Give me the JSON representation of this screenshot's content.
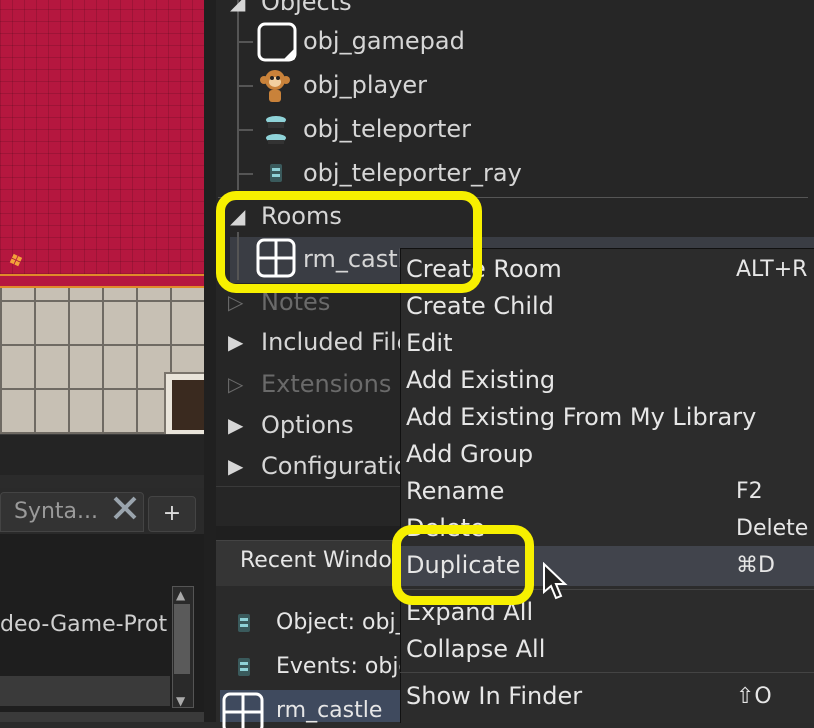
{
  "tree": {
    "objects_label": "Objects",
    "items": [
      {
        "label": "obj_gamepad",
        "icon": "gamepad-object-icon"
      },
      {
        "label": "obj_player",
        "icon": "monkey-sprite-icon"
      },
      {
        "label": "obj_teleporter",
        "icon": "teleporter-sprite-icon"
      },
      {
        "label": "obj_teleporter_ray",
        "icon": "teleporter-ray-sprite-icon"
      }
    ],
    "rooms_label": "Rooms",
    "room_item": "rm_castle",
    "notes_label": "Notes",
    "included_files_label": "Included File",
    "extensions_label": "Extensions",
    "options_label": "Options",
    "configurations_label": "Configuratio"
  },
  "bottom_left": {
    "syntax_tab": "Synta...",
    "close_icon": "x-icon",
    "plus": "+",
    "code_text": "deo-Game-Prot"
  },
  "recent": {
    "header": "Recent Window",
    "items": [
      "Object: obj_",
      "Events: obje",
      "rm_castle"
    ]
  },
  "menu": {
    "items": [
      {
        "label": "Create Room",
        "shortcut": "ALT+R"
      },
      {
        "label": "Create Child",
        "shortcut": ""
      },
      {
        "label": "Edit",
        "shortcut": ""
      },
      {
        "label": "Add Existing",
        "shortcut": ""
      },
      {
        "label": "Add Existing From My Library",
        "shortcut": ""
      },
      {
        "label": "Add Group",
        "shortcut": ""
      },
      {
        "label": "Rename",
        "shortcut": "F2"
      },
      {
        "label": "Delete",
        "shortcut": "Delete"
      },
      {
        "label": "Duplicate",
        "shortcut": "⌘D"
      },
      {
        "label": "Expand All",
        "shortcut": ""
      },
      {
        "label": "Collapse All",
        "shortcut": ""
      },
      {
        "label": "Show In Finder",
        "shortcut": "⇧O"
      }
    ]
  },
  "colors": {
    "highlight": "#f7f000",
    "selected_row": "#3a3d44",
    "carpet": "#b5173f"
  }
}
